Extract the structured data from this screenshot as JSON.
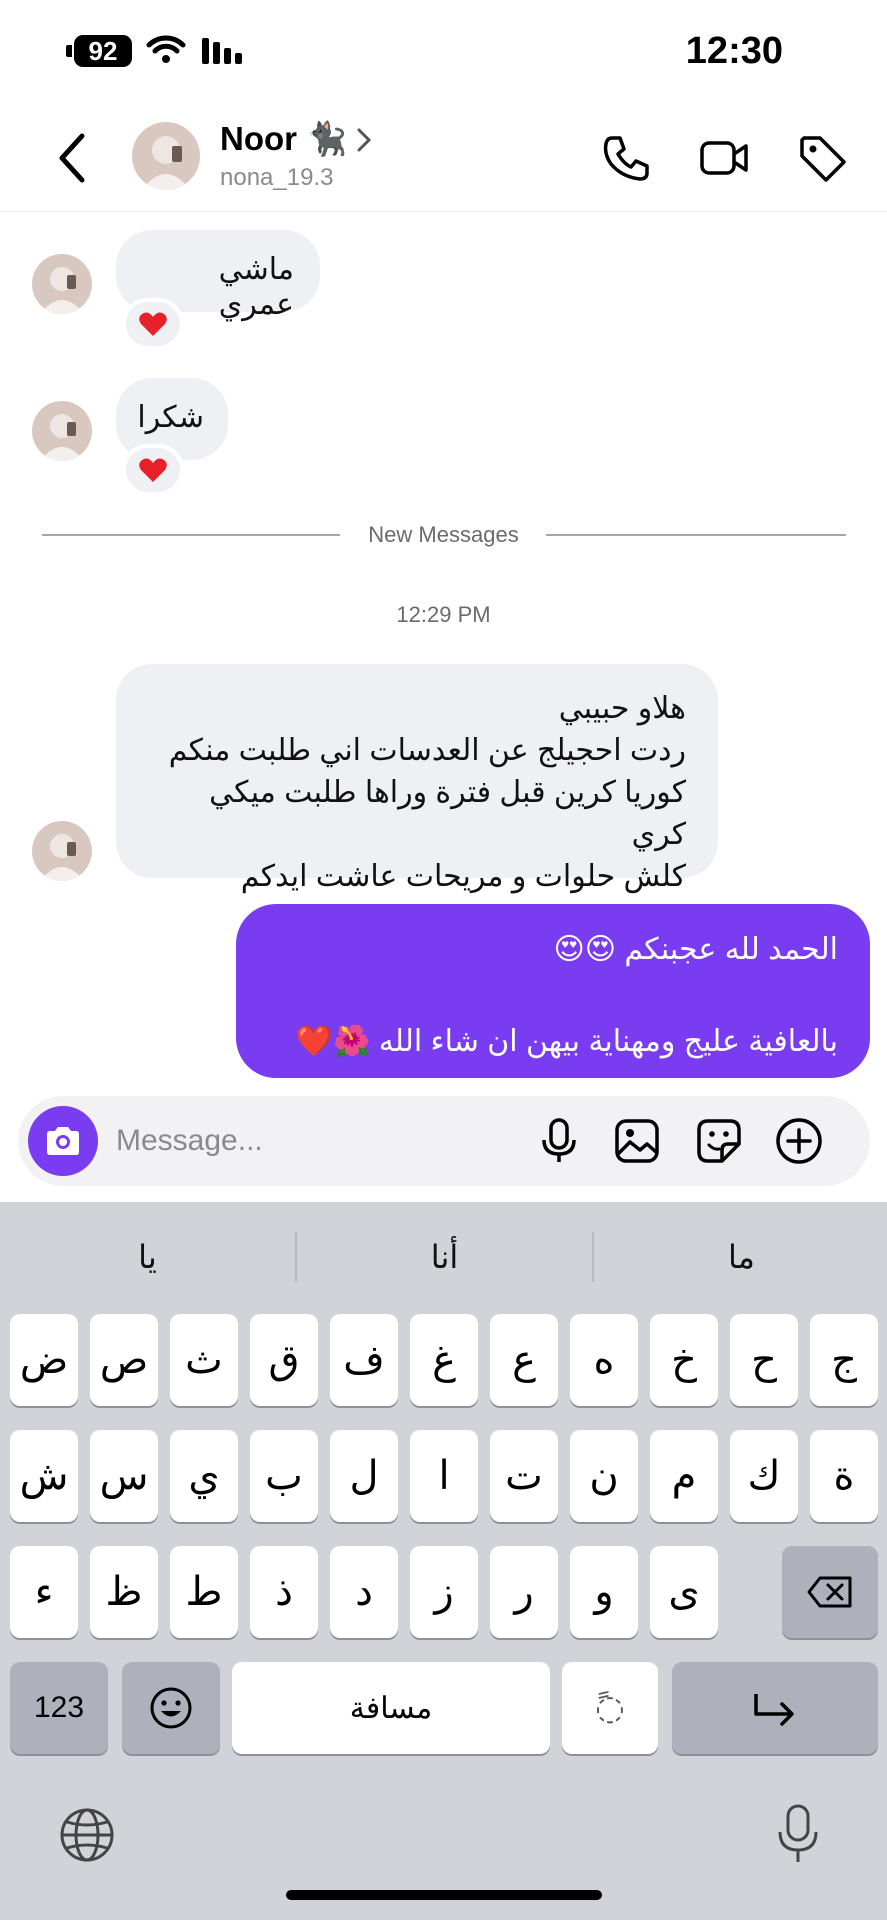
{
  "status": {
    "battery": "92",
    "time": "12:30"
  },
  "header": {
    "name": "Noor 🐈‍⬛",
    "username": "nona_19.3"
  },
  "messages": {
    "m1": {
      "text": "ماشي عمري",
      "reaction": "❤️"
    },
    "m2": {
      "text": "شكرا",
      "reaction": "❤️"
    },
    "divider": "New Messages",
    "timestamp": "12:29 PM",
    "m3": {
      "lines": [
        "هلاو حبيبي",
        "ردت احجيلج عن العدسات اني طلبت منكم",
        "كوريا كرين قبل فترة وراها طلبت ميكي كري",
        "كلش حلوات و مريحات عاشت ايدكم"
      ]
    },
    "m4": {
      "line1": "الحمد لله عجبنكم 😍😍",
      "line2": "بالعافية عليج ومهناية بيهن ان شاء الله 🌺❤️"
    }
  },
  "composer": {
    "placeholder": "Message..."
  },
  "keyboard": {
    "suggestions": [
      "يا",
      "أنا",
      "ما"
    ],
    "row1": [
      "ض",
      "ص",
      "ث",
      "ق",
      "ف",
      "غ",
      "ع",
      "ه",
      "خ",
      "ح",
      "ج"
    ],
    "row2": [
      "ش",
      "س",
      "ي",
      "ب",
      "ل",
      "ا",
      "ت",
      "ن",
      "م",
      "ك",
      "ة"
    ],
    "row3": [
      "ء",
      "ظ",
      "ط",
      "ذ",
      "د",
      "ز",
      "ر",
      "و",
      "ى"
    ],
    "numbers_label": "123",
    "space_label": "مسافة",
    "diacritic_label": "◌ً"
  },
  "colors": {
    "accent": "#7a3cf0",
    "bubble_in": "#eff0f3",
    "keyboard_bg": "#d1d3d9"
  },
  "icons": [
    "back-icon",
    "phone-icon",
    "video-icon",
    "tag-icon",
    "camera-icon",
    "mic-icon",
    "image-icon",
    "sticker-icon",
    "plus-icon",
    "emoji-icon",
    "return-icon",
    "delete-icon",
    "globe-icon",
    "dictation-icon"
  ]
}
